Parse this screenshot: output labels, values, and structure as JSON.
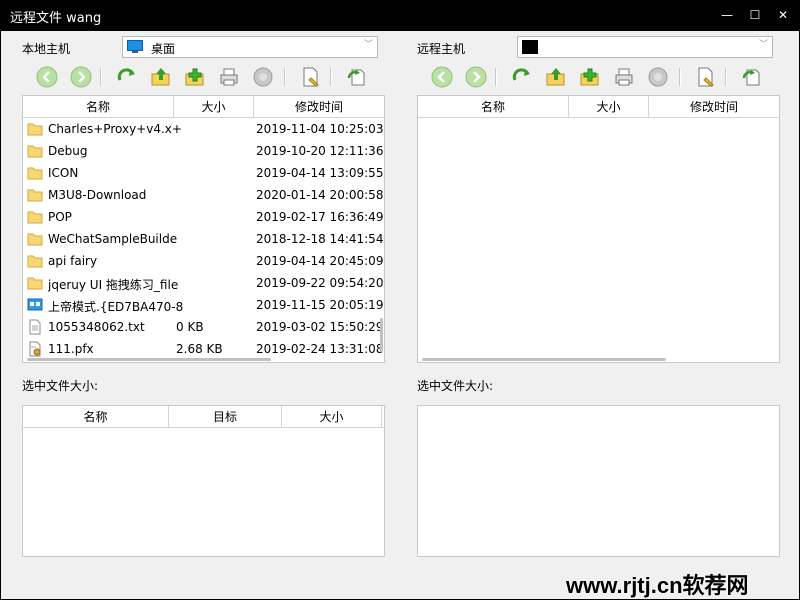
{
  "window": {
    "title": "远程文件 wang",
    "minimize": "—",
    "maximize": "☐",
    "close": "✕"
  },
  "local": {
    "host_label": "本地主机",
    "path": "桌面",
    "columns": [
      "名称",
      "大小",
      "修改时间"
    ],
    "rows": [
      {
        "icon": "folder-icon",
        "name": "Charles+Proxy+v4.x+",
        "size": "",
        "date": "2019-11-04 10:25:03"
      },
      {
        "icon": "folder-icon",
        "name": "Debug",
        "size": "",
        "date": "2019-10-20 12:11:36"
      },
      {
        "icon": "folder-icon",
        "name": "ICON",
        "size": "",
        "date": "2019-04-14 13:09:55"
      },
      {
        "icon": "folder-icon",
        "name": "M3U8-Download",
        "size": "",
        "date": "2020-01-14 20:00:58"
      },
      {
        "icon": "folder-icon",
        "name": "POP",
        "size": "",
        "date": "2019-02-17 16:36:49"
      },
      {
        "icon": "folder-icon",
        "name": "WeChatSampleBuilde",
        "size": "",
        "date": "2018-12-18 14:41:54"
      },
      {
        "icon": "folder-icon",
        "name": "api fairy",
        "size": "",
        "date": "2019-04-14 20:45:09"
      },
      {
        "icon": "folder-icon",
        "name": "jqeruy UI 拖拽练习_file",
        "size": "",
        "date": "2019-09-22 09:54:20"
      },
      {
        "icon": "special-folder-icon",
        "name": "上帝模式.{ED7BA470-8",
        "size": "",
        "date": "2019-11-15 20:05:19"
      },
      {
        "icon": "text-file-icon",
        "name": "1055348062.txt",
        "size": "0 KB",
        "date": "2019-03-02 15:50:29"
      },
      {
        "icon": "certificate-file-icon",
        "name": "111.pfx",
        "size": "2.68 KB",
        "date": "2019-02-24 13:31:08"
      }
    ],
    "selected_label": "选中文件大小:",
    "transfer_columns": [
      "名称",
      "目标",
      "大小"
    ]
  },
  "remote": {
    "host_label": "远程主机",
    "path": "",
    "columns": [
      "名称",
      "大小",
      "修改时间"
    ],
    "selected_label": "选中文件大小:"
  },
  "watermark": "www.rjtj.cn软荐网"
}
